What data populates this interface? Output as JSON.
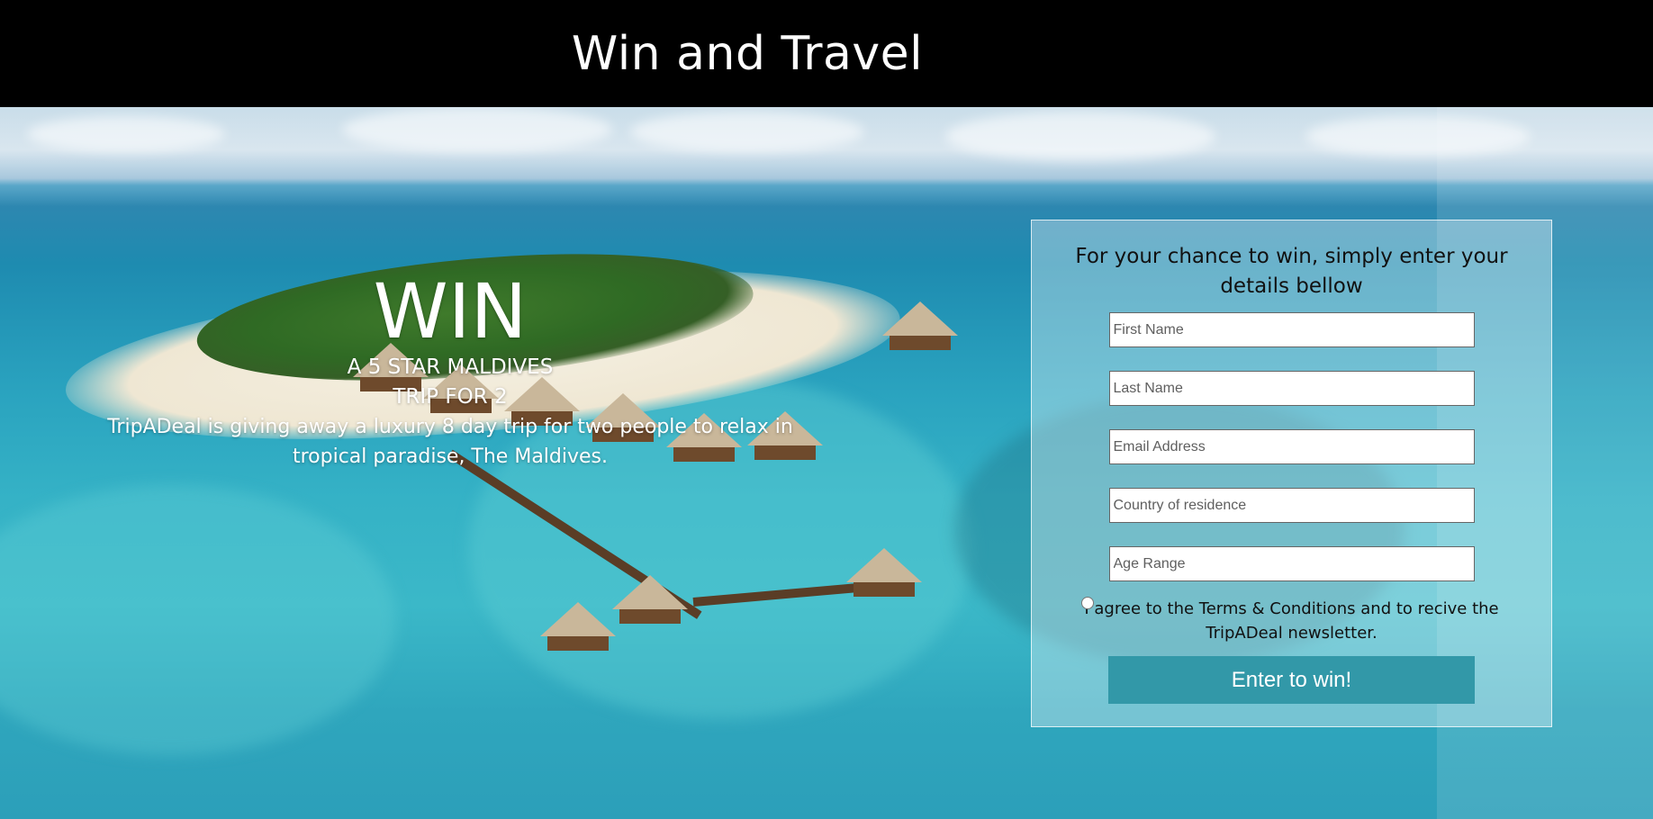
{
  "header": {
    "title": "Win and Travel"
  },
  "promo": {
    "headline": "WIN",
    "line1": "A 5 STAR MALDIVES",
    "line2": "TRIP FOR 2",
    "description": "TripADeal is giving away a luxury 8 day trip for two people to relax in tropical paradise, The Maldives."
  },
  "form": {
    "intro": "For your chance to win, simply enter your details bellow",
    "first_name_placeholder": "First Name",
    "last_name_placeholder": "Last Name",
    "email_placeholder": "Email Address",
    "country_placeholder": "Country of residence",
    "age_placeholder": "Age Range",
    "agree_label": "I agree to the Terms & Conditions and to recive the TripADeal newsletter.",
    "submit_label": "Enter to win!"
  },
  "colors": {
    "header_bg": "#000000",
    "button_bg": "#3298a8",
    "button_text": "#ffffff"
  }
}
